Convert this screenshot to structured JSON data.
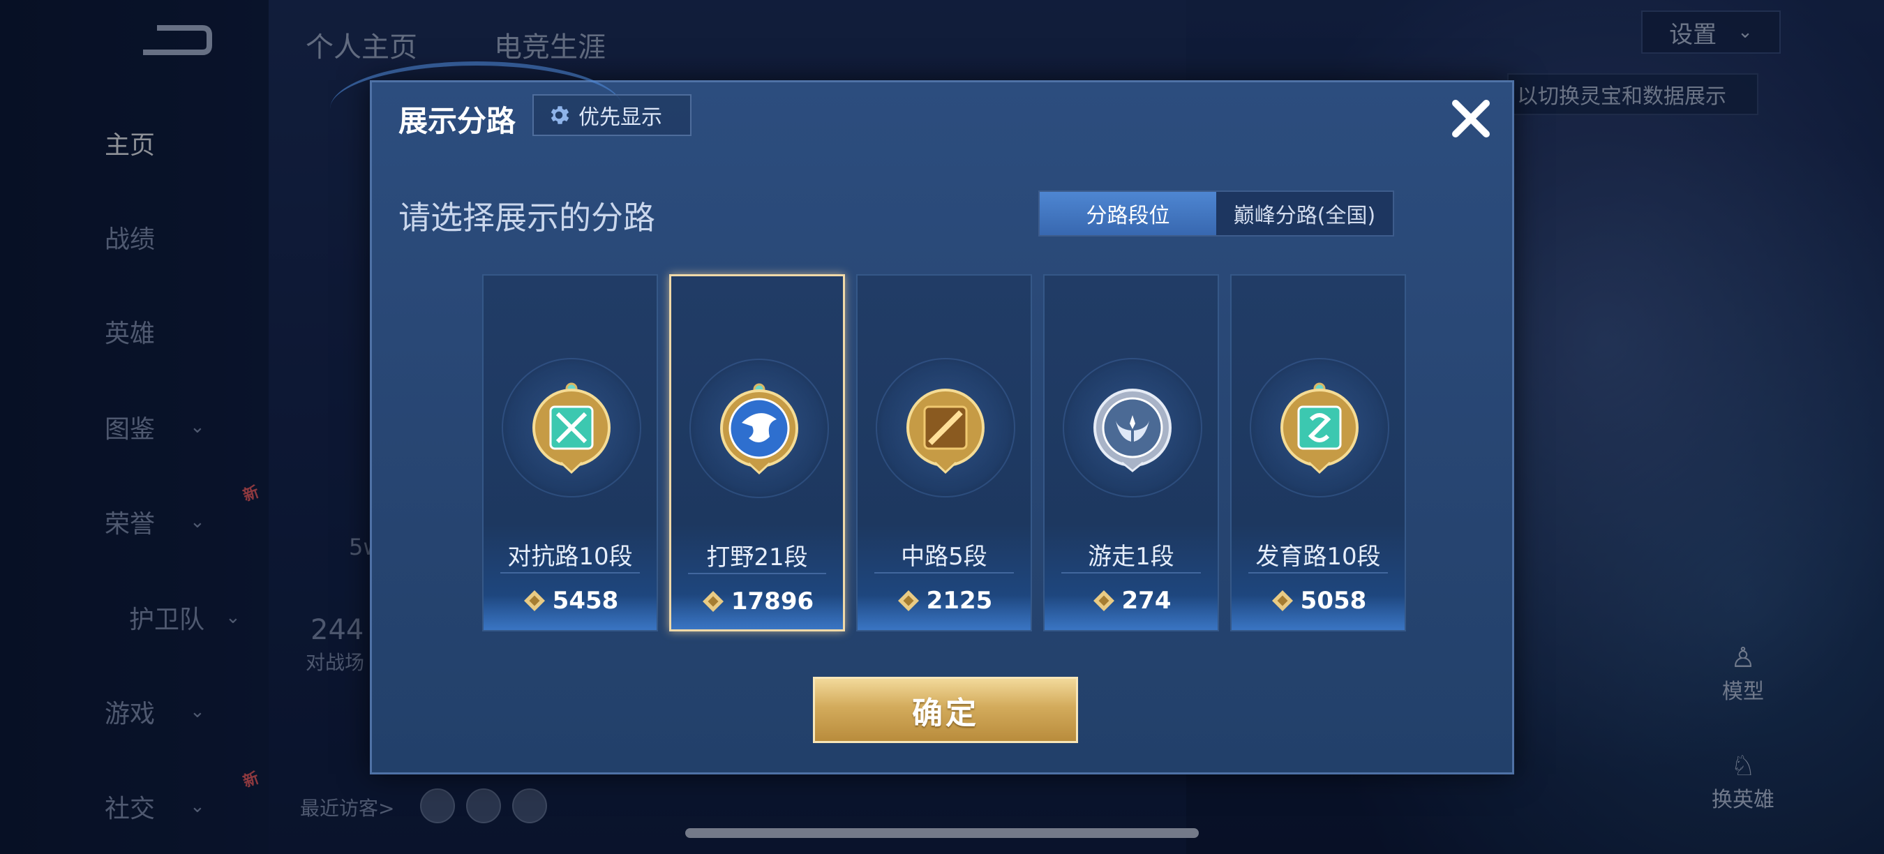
{
  "sidebar": {
    "items": [
      {
        "label": "主页",
        "active": true
      },
      {
        "label": "战绩"
      },
      {
        "label": "英雄"
      },
      {
        "label": "图鉴",
        "expand": true
      },
      {
        "label": "荣誉",
        "expand": true,
        "badge": "新"
      },
      {
        "label": "护卫队",
        "expand": true
      },
      {
        "label": "游戏",
        "expand": true
      },
      {
        "label": "社交",
        "expand": true,
        "badge": "新"
      }
    ]
  },
  "header": {
    "tabs": [
      "个人主页",
      "电竞生涯"
    ],
    "settings_label": "设置",
    "hint": "以切换灵宝和数据展示"
  },
  "background": {
    "stat_value": "244",
    "stat_label": "对战场",
    "left_partial": "5w",
    "visitors_label": "最近访客>",
    "model_label": "模型",
    "change_hero_label": "换英雄"
  },
  "dialog": {
    "title": "展示分路",
    "priority_label": "优先显示",
    "subtitle": "请选择展示的分路",
    "toggle": {
      "option1": "分路段位",
      "option2": "巅峰分路(全国)",
      "selected": "option1"
    },
    "cards": [
      {
        "rank": "对抗路10段",
        "score": "5458",
        "emblem": "crossed-swords-icon",
        "selected": false
      },
      {
        "rank": "打野21段",
        "score": "17896",
        "emblem": "dragon-icon",
        "selected": true
      },
      {
        "rank": "中路5段",
        "score": "2125",
        "emblem": "staff-icon",
        "selected": false
      },
      {
        "rank": "游走1段",
        "score": "274",
        "emblem": "wings-icon",
        "selected": false
      },
      {
        "rank": "发育路10段",
        "score": "5058",
        "emblem": "bow-icon",
        "selected": false
      }
    ],
    "confirm_label": "确定"
  },
  "colors": {
    "accent_blue": "#3868b0",
    "gold": "#d3ab5c",
    "selected_border": "#f0d9a8"
  }
}
